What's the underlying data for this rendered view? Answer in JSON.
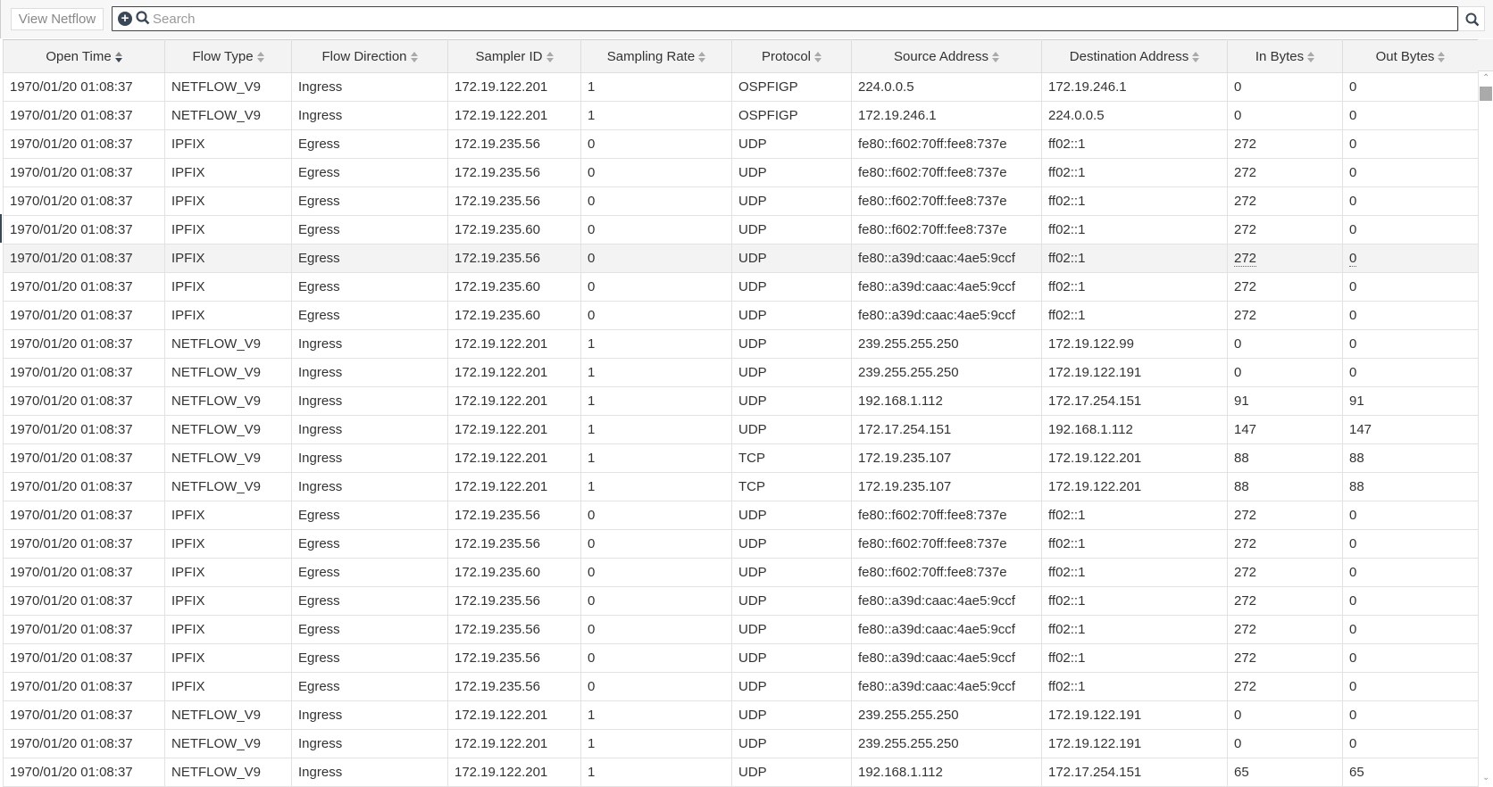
{
  "toolbar": {
    "view_button": "View Netflow",
    "search_placeholder": "Search",
    "search_value": ""
  },
  "table": {
    "columns": [
      "Open Time",
      "Flow Type",
      "Flow Direction",
      "Sampler ID",
      "Sampling Rate",
      "Protocol",
      "Source Address",
      "Destination Address",
      "In Bytes",
      "Out Bytes"
    ],
    "sorted_column": 0,
    "hover_row": 6,
    "rows": [
      [
        "1970/01/20 01:08:37",
        "NETFLOW_V9",
        "Ingress",
        "172.19.122.201",
        "1",
        "OSPFIGP",
        "224.0.0.5",
        "172.19.246.1",
        "0",
        "0"
      ],
      [
        "1970/01/20 01:08:37",
        "NETFLOW_V9",
        "Ingress",
        "172.19.122.201",
        "1",
        "OSPFIGP",
        "172.19.246.1",
        "224.0.0.5",
        "0",
        "0"
      ],
      [
        "1970/01/20 01:08:37",
        "IPFIX",
        "Egress",
        "172.19.235.56",
        "0",
        "UDP",
        "fe80::f602:70ff:fee8:737e",
        "ff02::1",
        "272",
        "0"
      ],
      [
        "1970/01/20 01:08:37",
        "IPFIX",
        "Egress",
        "172.19.235.56",
        "0",
        "UDP",
        "fe80::f602:70ff:fee8:737e",
        "ff02::1",
        "272",
        "0"
      ],
      [
        "1970/01/20 01:08:37",
        "IPFIX",
        "Egress",
        "172.19.235.56",
        "0",
        "UDP",
        "fe80::f602:70ff:fee8:737e",
        "ff02::1",
        "272",
        "0"
      ],
      [
        "1970/01/20 01:08:37",
        "IPFIX",
        "Egress",
        "172.19.235.60",
        "0",
        "UDP",
        "fe80::f602:70ff:fee8:737e",
        "ff02::1",
        "272",
        "0"
      ],
      [
        "1970/01/20 01:08:37",
        "IPFIX",
        "Egress",
        "172.19.235.56",
        "0",
        "UDP",
        "fe80::a39d:caac:4ae5:9ccf",
        "ff02::1",
        "272",
        "0"
      ],
      [
        "1970/01/20 01:08:37",
        "IPFIX",
        "Egress",
        "172.19.235.60",
        "0",
        "UDP",
        "fe80::a39d:caac:4ae5:9ccf",
        "ff02::1",
        "272",
        "0"
      ],
      [
        "1970/01/20 01:08:37",
        "IPFIX",
        "Egress",
        "172.19.235.60",
        "0",
        "UDP",
        "fe80::a39d:caac:4ae5:9ccf",
        "ff02::1",
        "272",
        "0"
      ],
      [
        "1970/01/20 01:08:37",
        "NETFLOW_V9",
        "Ingress",
        "172.19.122.201",
        "1",
        "UDP",
        "239.255.255.250",
        "172.19.122.99",
        "0",
        "0"
      ],
      [
        "1970/01/20 01:08:37",
        "NETFLOW_V9",
        "Ingress",
        "172.19.122.201",
        "1",
        "UDP",
        "239.255.255.250",
        "172.19.122.191",
        "0",
        "0"
      ],
      [
        "1970/01/20 01:08:37",
        "NETFLOW_V9",
        "Ingress",
        "172.19.122.201",
        "1",
        "UDP",
        "192.168.1.112",
        "172.17.254.151",
        "91",
        "91"
      ],
      [
        "1970/01/20 01:08:37",
        "NETFLOW_V9",
        "Ingress",
        "172.19.122.201",
        "1",
        "UDP",
        "172.17.254.151",
        "192.168.1.112",
        "147",
        "147"
      ],
      [
        "1970/01/20 01:08:37",
        "NETFLOW_V9",
        "Ingress",
        "172.19.122.201",
        "1",
        "TCP",
        "172.19.235.107",
        "172.19.122.201",
        "88",
        "88"
      ],
      [
        "1970/01/20 01:08:37",
        "NETFLOW_V9",
        "Ingress",
        "172.19.122.201",
        "1",
        "TCP",
        "172.19.235.107",
        "172.19.122.201",
        "88",
        "88"
      ],
      [
        "1970/01/20 01:08:37",
        "IPFIX",
        "Egress",
        "172.19.235.56",
        "0",
        "UDP",
        "fe80::f602:70ff:fee8:737e",
        "ff02::1",
        "272",
        "0"
      ],
      [
        "1970/01/20 01:08:37",
        "IPFIX",
        "Egress",
        "172.19.235.56",
        "0",
        "UDP",
        "fe80::f602:70ff:fee8:737e",
        "ff02::1",
        "272",
        "0"
      ],
      [
        "1970/01/20 01:08:37",
        "IPFIX",
        "Egress",
        "172.19.235.60",
        "0",
        "UDP",
        "fe80::f602:70ff:fee8:737e",
        "ff02::1",
        "272",
        "0"
      ],
      [
        "1970/01/20 01:08:37",
        "IPFIX",
        "Egress",
        "172.19.235.56",
        "0",
        "UDP",
        "fe80::a39d:caac:4ae5:9ccf",
        "ff02::1",
        "272",
        "0"
      ],
      [
        "1970/01/20 01:08:37",
        "IPFIX",
        "Egress",
        "172.19.235.56",
        "0",
        "UDP",
        "fe80::a39d:caac:4ae5:9ccf",
        "ff02::1",
        "272",
        "0"
      ],
      [
        "1970/01/20 01:08:37",
        "IPFIX",
        "Egress",
        "172.19.235.56",
        "0",
        "UDP",
        "fe80::a39d:caac:4ae5:9ccf",
        "ff02::1",
        "272",
        "0"
      ],
      [
        "1970/01/20 01:08:37",
        "IPFIX",
        "Egress",
        "172.19.235.56",
        "0",
        "UDP",
        "fe80::a39d:caac:4ae5:9ccf",
        "ff02::1",
        "272",
        "0"
      ],
      [
        "1970/01/20 01:08:37",
        "NETFLOW_V9",
        "Ingress",
        "172.19.122.201",
        "1",
        "UDP",
        "239.255.255.250",
        "172.19.122.191",
        "0",
        "0"
      ],
      [
        "1970/01/20 01:08:37",
        "NETFLOW_V9",
        "Ingress",
        "172.19.122.201",
        "1",
        "UDP",
        "239.255.255.250",
        "172.19.122.191",
        "0",
        "0"
      ],
      [
        "1970/01/20 01:08:37",
        "NETFLOW_V9",
        "Ingress",
        "172.19.122.201",
        "1",
        "UDP",
        "192.168.1.112",
        "172.17.254.151",
        "65",
        "65"
      ]
    ]
  }
}
